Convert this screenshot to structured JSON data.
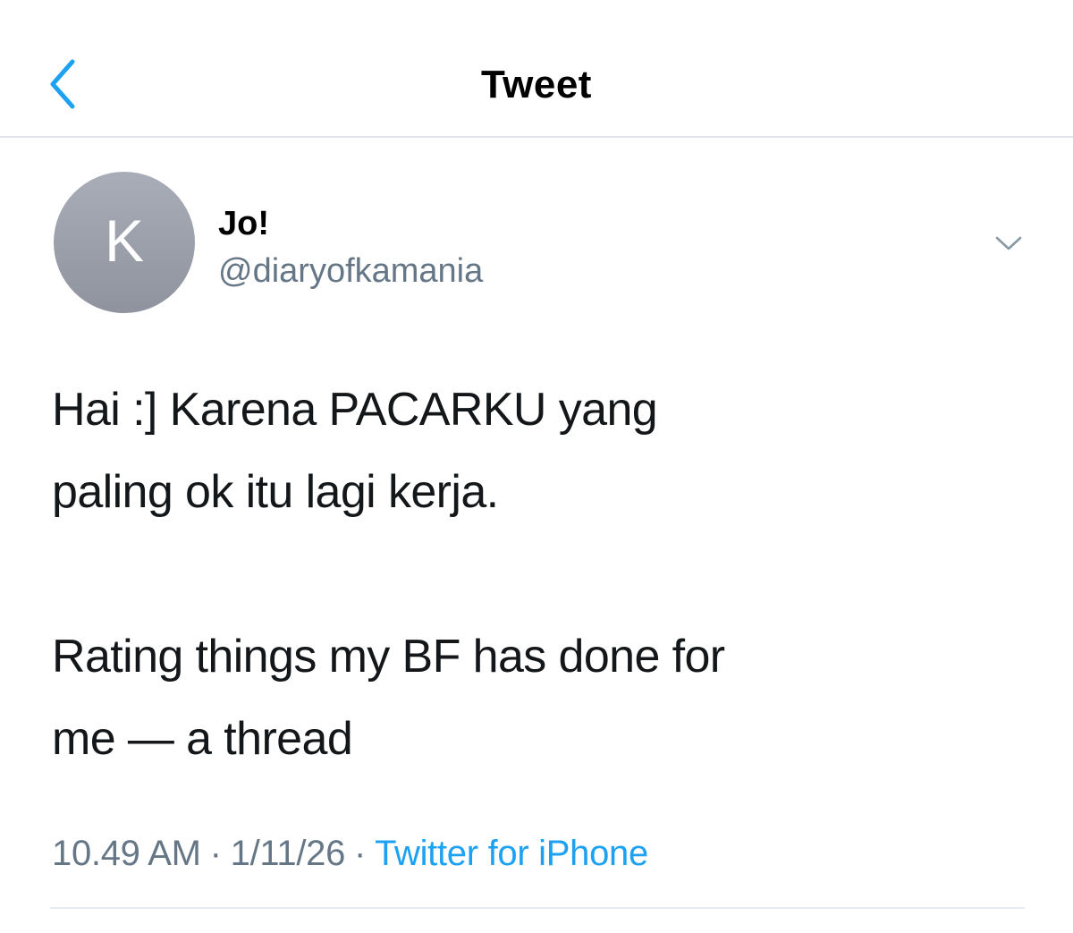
{
  "header": {
    "title": "Tweet",
    "back_icon": "chevron-left-icon",
    "accent_color": "#1da1f2"
  },
  "tweet": {
    "avatar_letter": "K",
    "display_name": "Jo!",
    "username": "@diaryofkamania",
    "menu_icon": "chevron-down-icon",
    "text_lines": [
      "Hai :] Karena PACARKU yang",
      "paling ok itu lagi kerja.",
      "",
      "Rating things my BF has done for",
      "me — a thread"
    ],
    "time": "10.49 AM",
    "date": "1/11/26",
    "source": "Twitter for iPhone",
    "separator": "·"
  },
  "colors": {
    "secondary_text": "#657786",
    "divider": "#e6ecf0",
    "avatar_bg": "#9ca0ab"
  }
}
